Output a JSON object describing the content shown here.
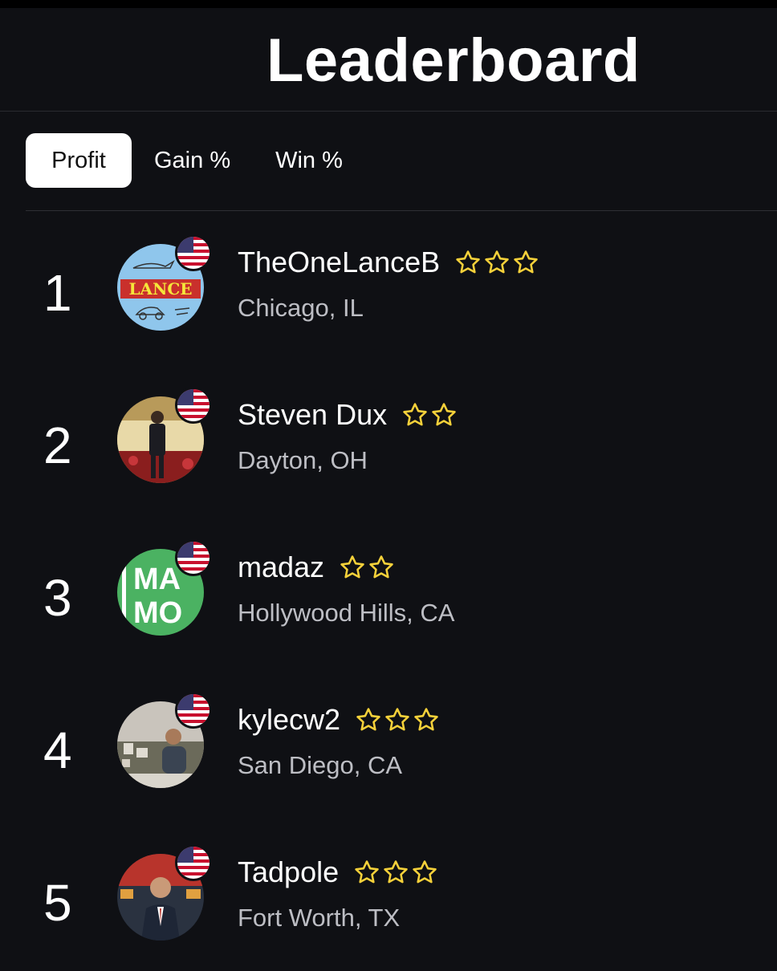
{
  "header": {
    "title": "Leaderboard"
  },
  "tabs": [
    {
      "label": "Profit",
      "active": true
    },
    {
      "label": "Gain %",
      "active": false
    },
    {
      "label": "Win %",
      "active": false
    }
  ],
  "colors": {
    "background": "#0f1014",
    "star": "#f5d13a",
    "secondary_text": "#bdbec4"
  },
  "leaders": [
    {
      "rank": "1",
      "username": "TheOneLanceB",
      "location": "Chicago, IL",
      "stars": 3,
      "flag": "us-flag-icon",
      "avatar_text": "LANCE"
    },
    {
      "rank": "2",
      "username": "Steven Dux",
      "location": "Dayton, OH",
      "stars": 2,
      "flag": "us-flag-icon"
    },
    {
      "rank": "3",
      "username": "madaz",
      "location": "Hollywood Hills, CA",
      "stars": 2,
      "flag": "us-flag-icon",
      "avatar_text_top": "MA",
      "avatar_text_bottom": "MO"
    },
    {
      "rank": "4",
      "username": "kylecw2",
      "location": "San Diego, CA",
      "stars": 3,
      "flag": "us-flag-icon"
    },
    {
      "rank": "5",
      "username": "Tadpole",
      "location": "Fort Worth, TX",
      "stars": 3,
      "flag": "us-flag-icon"
    }
  ]
}
